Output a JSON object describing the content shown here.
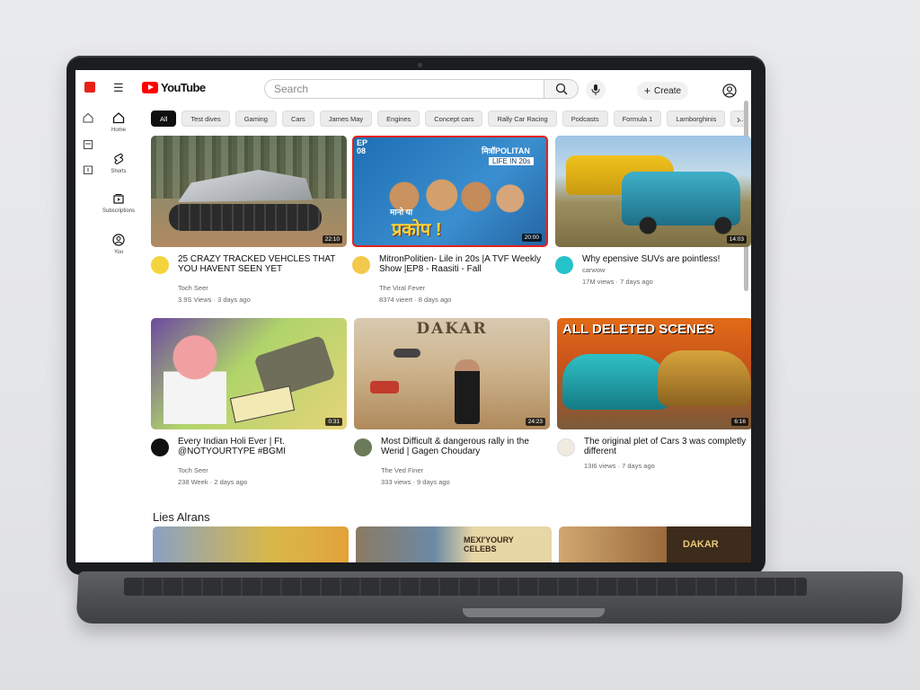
{
  "header": {
    "search_placeholder": "Search",
    "brand": "YouTube",
    "create_label": "Create"
  },
  "sidebar": {
    "items": [
      {
        "label": "Home",
        "icon": "home-icon"
      },
      {
        "label": "Shorts",
        "icon": "shorts-icon"
      },
      {
        "label": "Subscriptions",
        "icon": "subscriptions-icon"
      },
      {
        "label": "You",
        "icon": "you-icon"
      }
    ]
  },
  "chips": [
    "All",
    "Test dives",
    "Gaming",
    "Cars",
    "James May",
    "Engines",
    "Concept cars",
    "Rally Car Racing",
    "Podcasts",
    "Formula 1",
    "Lamborghinis",
    "..."
  ],
  "videos": [
    {
      "title": "25 CRAZY  TRACKED VEHCLES THAT YOU HAVENT SEEN YET",
      "channel": "Toch Seer",
      "views": "3.9S Views",
      "age": "3 days ago",
      "duration": "22:10"
    },
    {
      "title": "MitronPolitien- Lile in 20s |A TVF Weekly Show |EP8 - Raasiti - Fall",
      "channel": "The Viral Fever",
      "views": "8374 vieert",
      "age": "8 days ago",
      "duration": "20:00"
    },
    {
      "title": "Why epensive SUVs are pointless!",
      "channel": "carwow",
      "views": "17M views",
      "age": "7 days ago",
      "duration": "14:03"
    },
    {
      "title": "Every Indian Holi Ever | Ft. @NOTYOURTYPE #BGMI",
      "channel": "Toch Seer",
      "views": "238 Week",
      "age": "2 days ago",
      "duration": "0:31"
    },
    {
      "title": "Most Difficult & dangerous rally in the Werid | Gagen Choudary",
      "channel": "The Ved Finer",
      "views": "333 views",
      "age": "9 days ago",
      "duration": "24:23"
    },
    {
      "title": "The original plet of Cars 3 was completly different",
      "channel": "",
      "views": "13I6 views",
      "age": "7 days ago",
      "duration": "6:16"
    }
  ],
  "thumb_text": {
    "ep_badge": "EP 08",
    "mitron_title": "मित्रॉPOLITAN",
    "mitron_sub": "LIFE IN 20s",
    "mitron_hindi_small": "मानो या",
    "mitron_hindi_big": "प्रकोप !",
    "dakar": "DAKAR",
    "deleted_scenes": "ALL DELETED SCENES",
    "mexico_text": "MEXI'YOURY CELEBS",
    "dakar_small": "DAKAR"
  },
  "section_title": "Lies Alrans",
  "colors": {
    "brand_red": "#ff0000",
    "highlight": "#e62117"
  }
}
